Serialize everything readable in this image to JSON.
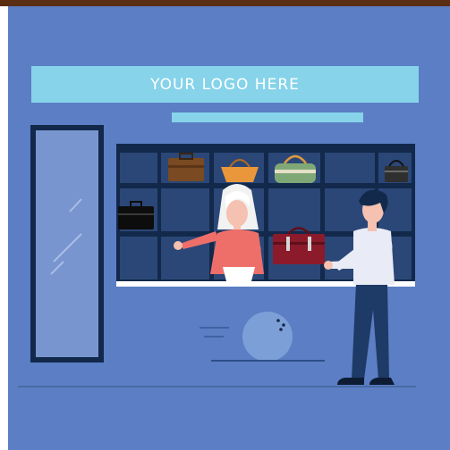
{
  "banner": {
    "logo_text": "YOUR LOGO HERE"
  },
  "colors": {
    "background": "#5b7ec4",
    "banner": "#86d3ea",
    "shelf": "#13294b",
    "top_bar": "#5a2e12",
    "woman_shirt": "#ee6f6a",
    "man_shirt": "#e9ecf6",
    "man_pants": "#1e3a66",
    "featured_bag": "#8b1a2a"
  },
  "icons": {
    "bags": [
      "briefcase-icon",
      "tote-bag-icon",
      "duffel-bag-icon",
      "black-handbag-icon",
      "black-briefcase-icon",
      "red-briefcase-icon"
    ],
    "other": [
      "mirror-icon",
      "ball-icon"
    ]
  }
}
